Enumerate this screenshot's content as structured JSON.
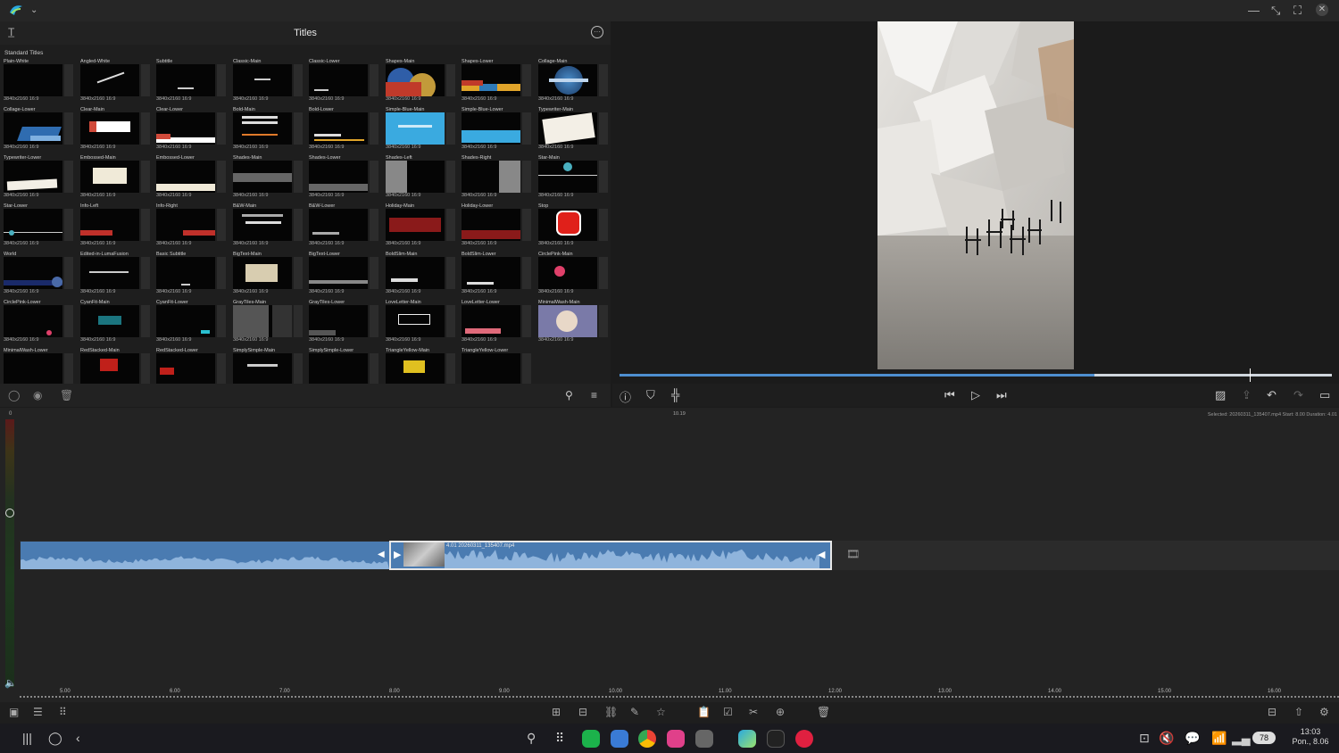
{
  "titles_panel": {
    "title": "Titles",
    "section": "Standard Titles",
    "tiles": [
      {
        "name": "Plain-White",
        "meta": "3840x2160 16:9",
        "style": "plain"
      },
      {
        "name": "Angled-White",
        "meta": "3840x2160 16:9",
        "style": "angled"
      },
      {
        "name": "Subtitle",
        "meta": "3840x2160 16:9",
        "style": "subtitle"
      },
      {
        "name": "Classic-Main",
        "meta": "3840x2160 16:9",
        "style": "classic"
      },
      {
        "name": "Classic-Lower",
        "meta": "3840x2160 16:9",
        "style": "classiclower"
      },
      {
        "name": "Shapes-Main",
        "meta": "3840x2160 16:9",
        "style": "shapes"
      },
      {
        "name": "Shapes-Lower",
        "meta": "3840x2160 16:9",
        "style": "shapeslower"
      },
      {
        "name": "Collage-Main",
        "meta": "3840x2160 16:9",
        "style": "collage"
      },
      {
        "name": "Collage-Lower",
        "meta": "3840x2160 16:9",
        "style": "collagelower"
      },
      {
        "name": "Clear-Main",
        "meta": "3840x2160 16:9",
        "style": "clear"
      },
      {
        "name": "Clear-Lower",
        "meta": "3840x2160 16:9",
        "style": "clearlower"
      },
      {
        "name": "Bold-Main",
        "meta": "3840x2160 16:9",
        "style": "bold"
      },
      {
        "name": "Bold-Lower",
        "meta": "3840x2160 16:9",
        "style": "boldlower"
      },
      {
        "name": "Simple-Blue-Main",
        "meta": "3840x2160 16:9",
        "style": "blue"
      },
      {
        "name": "Simple-Blue-Lower",
        "meta": "3840x2160 16:9",
        "style": "bluelower"
      },
      {
        "name": "Typewriter-Main",
        "meta": "3840x2160 16:9",
        "style": "typewriter"
      },
      {
        "name": "Typewriter-Lower",
        "meta": "3840x2160 16:9",
        "style": "typelower"
      },
      {
        "name": "Embossed-Main",
        "meta": "3840x2160 16:9",
        "style": "embossed"
      },
      {
        "name": "Embossed-Lower",
        "meta": "3840x2160 16:9",
        "style": "embossedlower"
      },
      {
        "name": "Shades-Main",
        "meta": "3840x2160 16:9",
        "style": "shades"
      },
      {
        "name": "Shades-Lower",
        "meta": "3840x2160 16:9",
        "style": "shadeslower"
      },
      {
        "name": "Shades-Left",
        "meta": "3840x2160 16:9",
        "style": "shadesleft"
      },
      {
        "name": "Shades-Right",
        "meta": "3840x2160 16:9",
        "style": "shadesright"
      },
      {
        "name": "Star-Main",
        "meta": "3840x2160 16:9",
        "style": "star"
      },
      {
        "name": "Star-Lower",
        "meta": "3840x2160 16:9",
        "style": "starlower"
      },
      {
        "name": "Info-Left",
        "meta": "3840x2160 16:9",
        "style": "infoleft"
      },
      {
        "name": "Info-Right",
        "meta": "3840x2160 16:9",
        "style": "inforight"
      },
      {
        "name": "B&W-Main",
        "meta": "3840x2160 16:9",
        "style": "bw"
      },
      {
        "name": "B&W-Lower",
        "meta": "3840x2160 16:9",
        "style": "bwlower"
      },
      {
        "name": "Holiday-Main",
        "meta": "3840x2160 16:9",
        "style": "holiday"
      },
      {
        "name": "Holiday-Lower",
        "meta": "3840x2160 16:9",
        "style": "holidaylower"
      },
      {
        "name": "Stop",
        "meta": "3840x2160 16:9",
        "style": "stop"
      },
      {
        "name": "World",
        "meta": "3840x2160 16:9",
        "style": "world"
      },
      {
        "name": "Edited-in-LumaFusion",
        "meta": "3840x2160 16:9",
        "style": "luma"
      },
      {
        "name": "Basic Subtitle",
        "meta": "3840x2160 16:9",
        "style": "basic"
      },
      {
        "name": "BigText-Main",
        "meta": "3840x2160 16:9",
        "style": "bigtext"
      },
      {
        "name": "BigText-Lower",
        "meta": "3840x2160 16:9",
        "style": "bigtextlower"
      },
      {
        "name": "BoldSlim-Main",
        "meta": "3840x2160 16:9",
        "style": "boldslim"
      },
      {
        "name": "BoldSlim-Lower",
        "meta": "3840x2160 16:9",
        "style": "boldslimlower"
      },
      {
        "name": "CirclePink-Main",
        "meta": "3840x2160 16:9",
        "style": "circlepink"
      },
      {
        "name": "CirclePink-Lower",
        "meta": "3840x2160 16:9",
        "style": "circlepinklower"
      },
      {
        "name": "CyanFit-Main",
        "meta": "3840x2160 16:9",
        "style": "cyanfit"
      },
      {
        "name": "CyanFit-Lower",
        "meta": "3840x2160 16:9",
        "style": "cyanfitlower"
      },
      {
        "name": "GrayTiles-Main",
        "meta": "3840x2160 16:9",
        "style": "graytiles"
      },
      {
        "name": "GrayTiles-Lower",
        "meta": "3840x2160 16:9",
        "style": "graytileslower"
      },
      {
        "name": "LoveLetter-Main",
        "meta": "3840x2160 16:9",
        "style": "loveletter"
      },
      {
        "name": "LoveLetter-Lower",
        "meta": "3840x2160 16:9",
        "style": "loveletterlower"
      },
      {
        "name": "MinimalWash-Main",
        "meta": "3840x2160 16:9",
        "style": "minimalwash"
      },
      {
        "name": "MinimalWash-Lower",
        "meta": "",
        "style": "minimalwashlower"
      },
      {
        "name": "RedStacked-Main",
        "meta": "",
        "style": "redstacked"
      },
      {
        "name": "RedStacked-Lower",
        "meta": "",
        "style": "redstackedlower"
      },
      {
        "name": "SimplySimple-Main",
        "meta": "",
        "style": "simplysimple"
      },
      {
        "name": "SimplySimple-Lower",
        "meta": "",
        "style": "simplysimplelower"
      },
      {
        "name": "TriangleYellow-Main",
        "meta": "",
        "style": "triangleyellow"
      },
      {
        "name": "TriangleYellow-Lower",
        "meta": "",
        "style": "triangleyellowlower"
      }
    ]
  },
  "timeline": {
    "level_top": "0",
    "playhead_time": "10.19",
    "selected_info": "Selected: 20260311_135407.mp4 Start: 8.00 Duration: 4.01",
    "clip_label": "4.01 20260311_135407.mp4",
    "ruler": [
      "5.00",
      "6.00",
      "7.00",
      "8.00",
      "9.00",
      "10.00",
      "11.00",
      "12.00",
      "13.00",
      "14.00",
      "15.00",
      "16.00"
    ]
  },
  "scrubber": {
    "played_fraction": 0.667
  },
  "status": {
    "time": "13:03",
    "date": "Pon., 8.06",
    "battery": "78"
  },
  "colors": {
    "clip_blue": "#4a7bb1",
    "playhead": "#3f6fa5",
    "panel_bg": "#1e1e1e"
  }
}
